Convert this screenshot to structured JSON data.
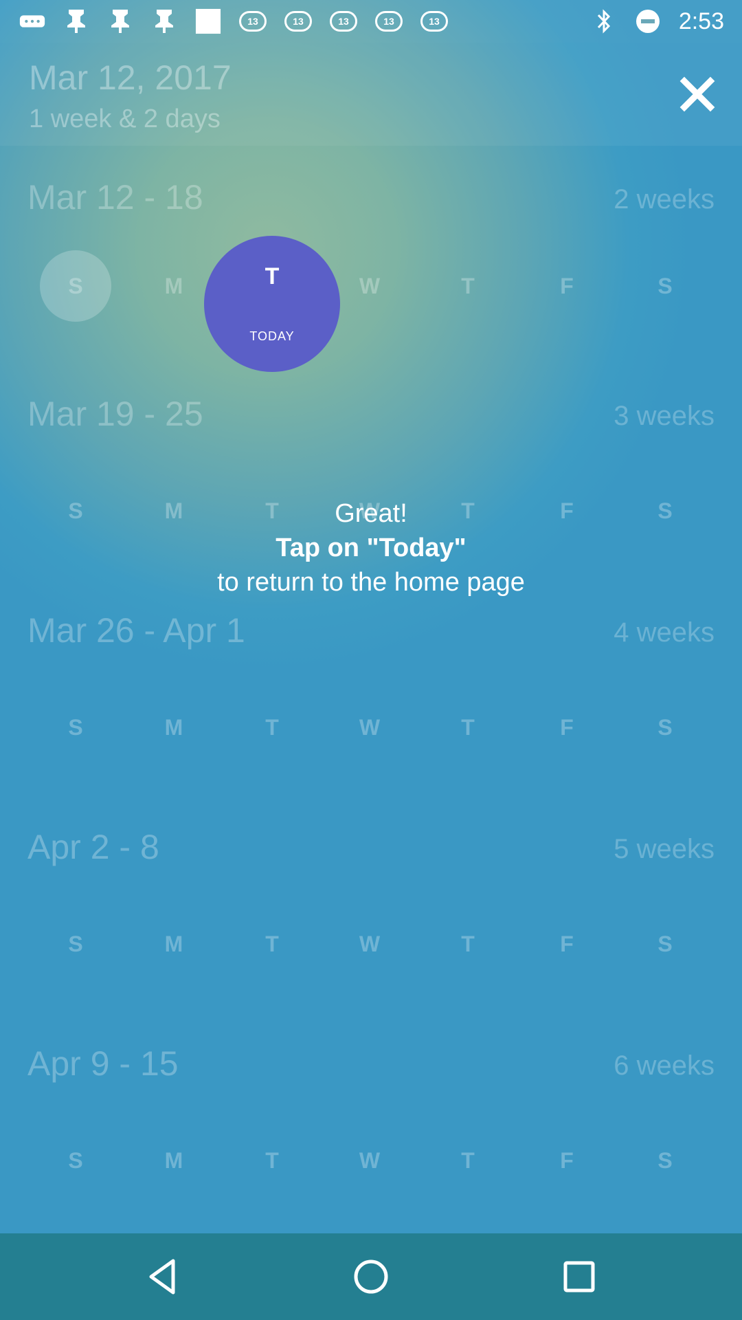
{
  "status_bar": {
    "time": "2:53",
    "badge_text": "13",
    "icons": [
      "more-icon",
      "pinterest-icon",
      "pinterest-icon",
      "pinterest-icon",
      "square-icon",
      "abc13-icon",
      "abc13-icon",
      "abc13-icon",
      "abc13-icon",
      "abc13-icon",
      "bluetooth-icon",
      "do-not-disturb-icon"
    ]
  },
  "header": {
    "date": "Mar 12, 2017",
    "subtitle": "1 week & 2 days",
    "close_icon": "close-icon"
  },
  "weeks": [
    {
      "range": "Mar 12 - 18",
      "count": "2 weeks",
      "days": [
        "S",
        "M",
        "",
        "W",
        "T",
        "F",
        "S"
      ]
    },
    {
      "range": "Mar 19 - 25",
      "count": "3 weeks",
      "days": [
        "S",
        "M",
        "T",
        "W",
        "T",
        "F",
        "S"
      ]
    },
    {
      "range": "Mar 26 - Apr 1",
      "count": "4 weeks",
      "days": [
        "S",
        "M",
        "T",
        "W",
        "T",
        "F",
        "S"
      ]
    },
    {
      "range": "Apr 2 - 8",
      "count": "5 weeks",
      "days": [
        "S",
        "M",
        "T",
        "W",
        "T",
        "F",
        "S"
      ]
    },
    {
      "range": "Apr 9 - 15",
      "count": "6 weeks",
      "days": [
        "S",
        "M",
        "T",
        "W",
        "T",
        "F",
        "S"
      ]
    }
  ],
  "today_button": {
    "letter": "T",
    "label": "TODAY",
    "color": "#5b5fc7"
  },
  "hint": {
    "line1": "Great!",
    "line2": "Tap on \"Today\"",
    "line3": "to return to the home page"
  },
  "nav": {
    "back_icon": "back-icon",
    "home_icon": "home-icon",
    "recents_icon": "recents-icon"
  }
}
